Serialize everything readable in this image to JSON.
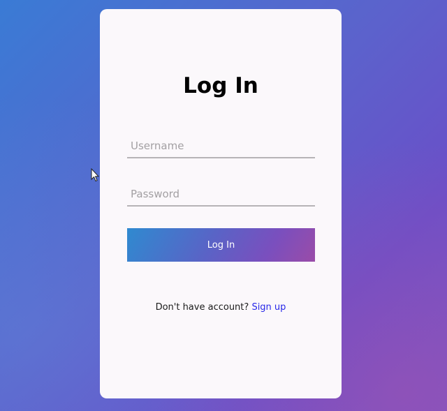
{
  "login": {
    "title": "Log In",
    "username_placeholder": "Username",
    "password_placeholder": "Password",
    "button_label": "Log In",
    "signup_prompt": "Don't have account?",
    "signup_link": "Sign up"
  },
  "colors": {
    "background_start": "#3a7bd5",
    "background_end": "#6a4fc8",
    "card": "#fbf8fb",
    "button_start": "#2f8ad0",
    "button_end": "#9a4ca8",
    "link": "#2727e8"
  },
  "icons": {
    "cursor": "mouse-pointer-icon"
  }
}
